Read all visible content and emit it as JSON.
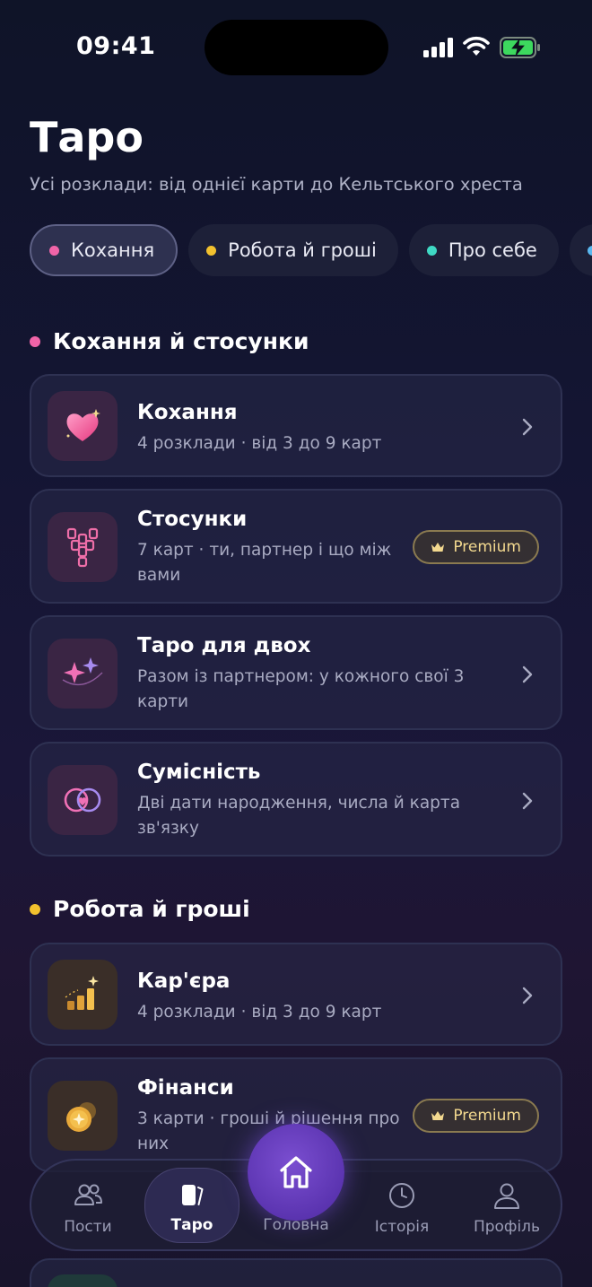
{
  "status": {
    "time": "09:41"
  },
  "header": {
    "title": "Таро",
    "subtitle": "Усі розклади: від однієї карти до Кельтського хреста"
  },
  "filters": [
    {
      "label": "Кохання",
      "color": "#f064a8",
      "active": true
    },
    {
      "label": "Робота й гроші",
      "color": "#f2c12e",
      "active": false
    },
    {
      "label": "Про себе",
      "color": "#3fd9c4",
      "active": false
    },
    {
      "label": "",
      "color": "#5ab8f0",
      "active": false
    }
  ],
  "sections": [
    {
      "title": "Кохання й стосунки",
      "color": "#f064a8",
      "cards": [
        {
          "title": "Кохання",
          "description": "4 розклади · від 3 до 9 карт",
          "icon": "heart-icon",
          "premium": false
        },
        {
          "title": "Стосунки",
          "description": "7 карт · ти, партнер і що між вами",
          "icon": "card-spread-icon",
          "premium": true,
          "badge": "Premium"
        },
        {
          "title": "Таро для двох",
          "description": "Разом із партнером: у кожного свої 3 карти",
          "icon": "sparkles-icon",
          "premium": false
        },
        {
          "title": "Сумісність",
          "description": "Дві дати народження, числа й карта зв'язку",
          "icon": "rings-icon",
          "premium": false
        }
      ]
    },
    {
      "title": "Робота й гроші",
      "color": "#f2c12e",
      "cards": [
        {
          "title": "Кар'єра",
          "description": "4 розклади · від 3 до 9 карт",
          "icon": "growth-chart-icon",
          "premium": false
        },
        {
          "title": "Фінанси",
          "description": "3 карти · гроші й рішення про них",
          "icon": "coin-icon",
          "premium": true,
          "badge": "Premium"
        }
      ]
    }
  ],
  "tabbar": {
    "items": [
      {
        "label": "Пости",
        "icon": "people-icon",
        "active": false
      },
      {
        "label": "Таро",
        "icon": "cards-icon",
        "active": true
      },
      {
        "label": "Головна",
        "icon": "home-icon",
        "active": false
      },
      {
        "label": "Історія",
        "icon": "clock-icon",
        "active": false
      },
      {
        "label": "Профіль",
        "icon": "profile-icon",
        "active": false
      }
    ]
  }
}
